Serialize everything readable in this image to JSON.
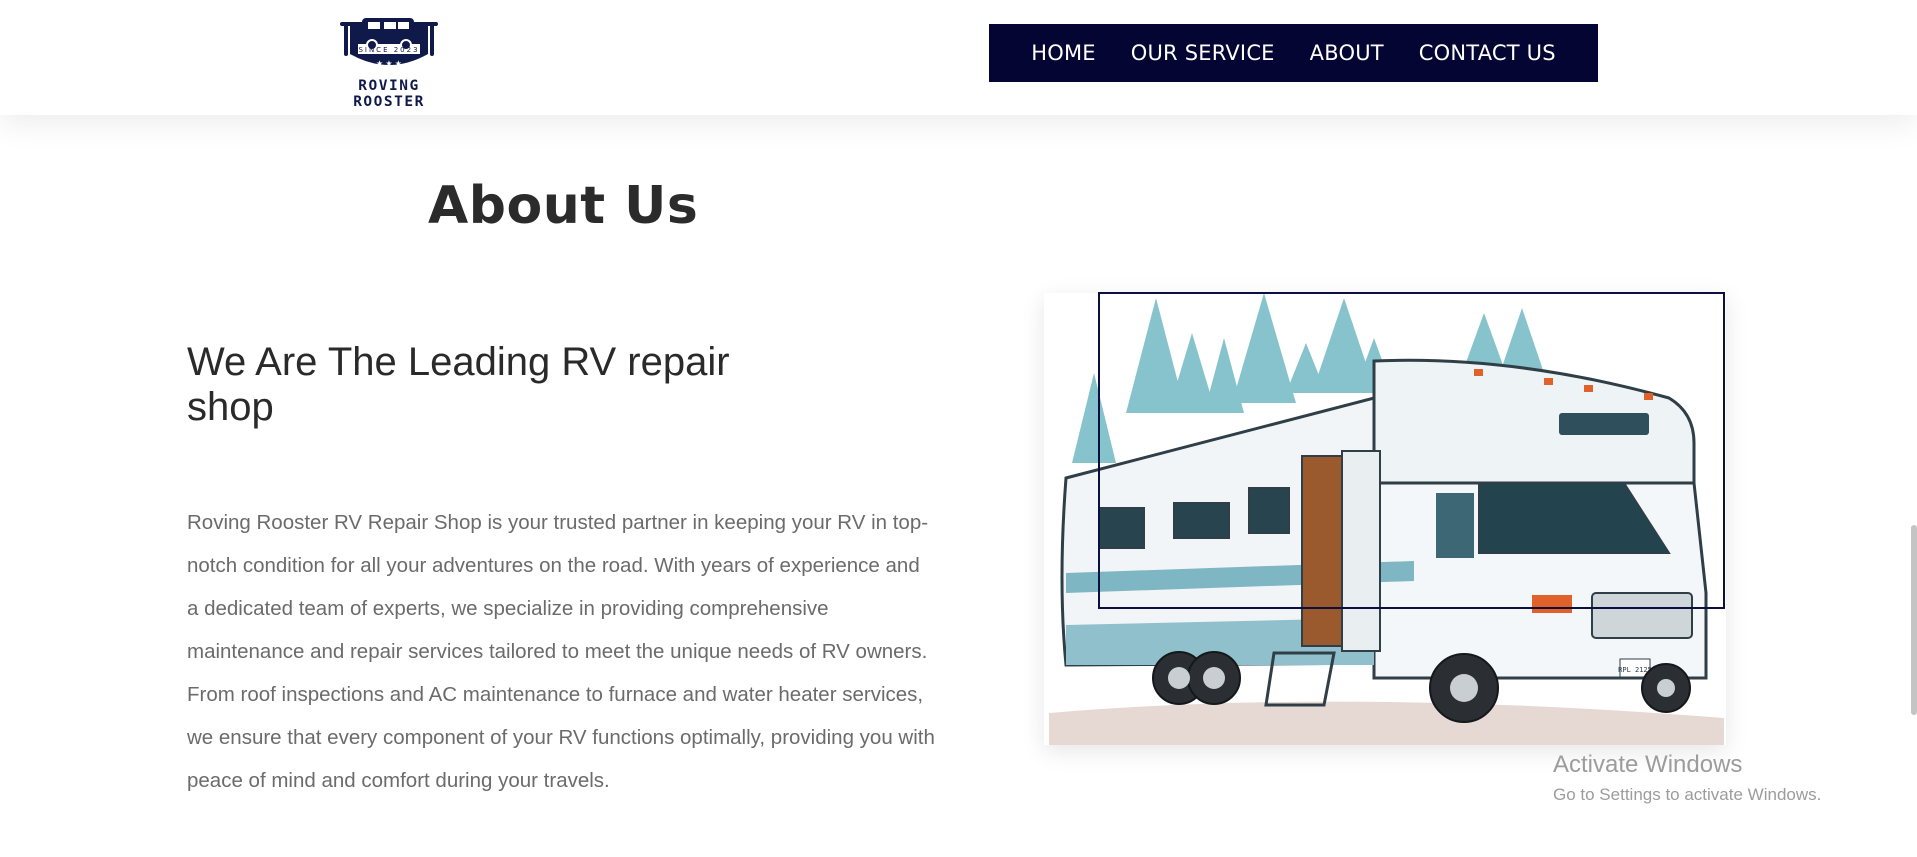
{
  "brand": {
    "logo_since": "SINCE 2023",
    "logo_name": "ROVING ROOSTER",
    "nav_color": "#040532"
  },
  "nav": {
    "items": [
      "HOME",
      "OUR SERVICE",
      "ABOUT",
      "CONTACT US"
    ]
  },
  "about": {
    "title": "About Us",
    "heading": "We Are The Leading RV repair shop",
    "body": "Roving Rooster RV Repair Shop is your trusted partner in keeping your RV in top-notch condition for all your adventures on the road. With years of experience and a dedicated team of experts, we specialize in providing comprehensive maintenance and repair services tailored to meet the unique needs of RV owners. From roof inspections and AC maintenance to furnace and water heater services, we ensure that every component of your RV functions optimally, providing you with peace of mind and comfort during your travels."
  },
  "illustration": {
    "plate_text": "RPL 2125"
  },
  "watermark": {
    "title": "Activate Windows",
    "subtitle": "Go to Settings to activate Windows."
  }
}
